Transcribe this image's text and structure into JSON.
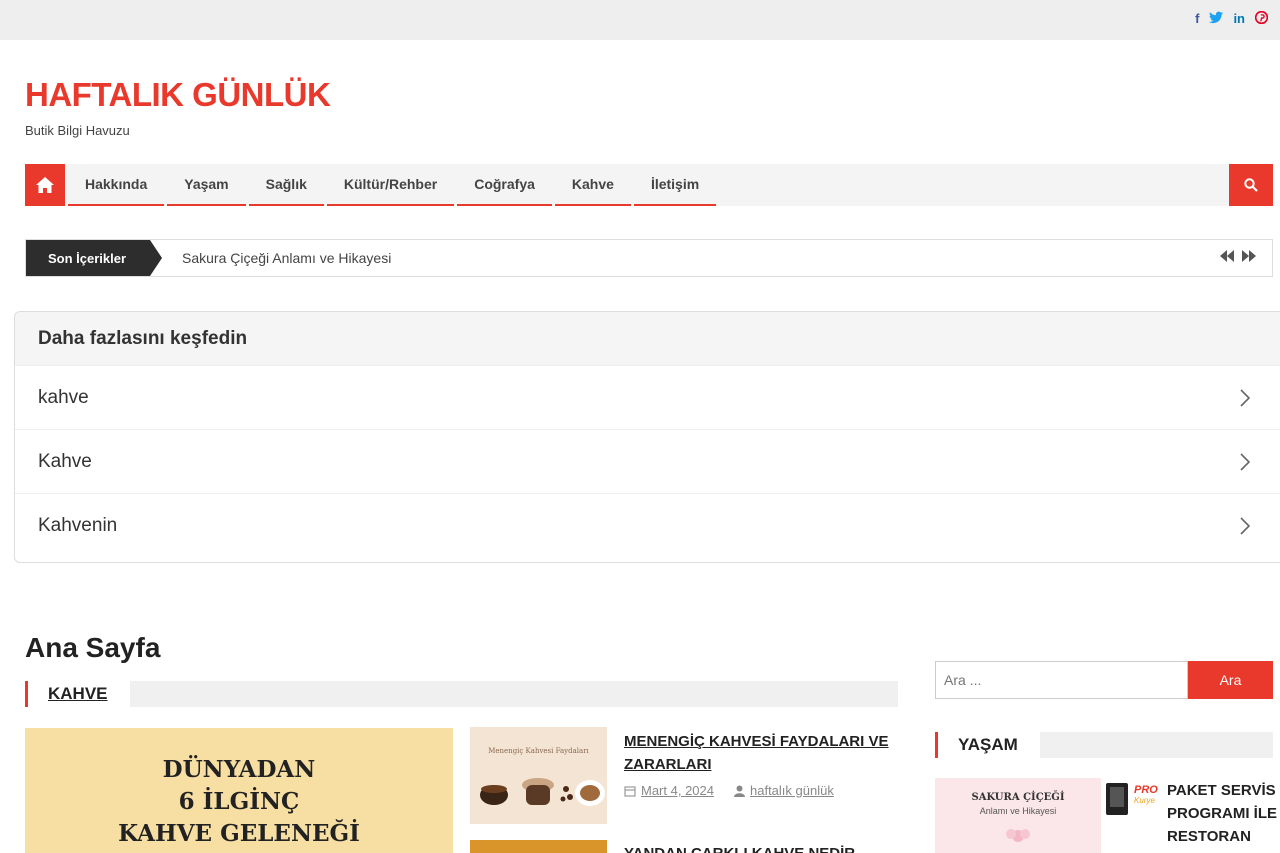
{
  "topbar": {
    "social": [
      {
        "name": "facebook-icon",
        "glyph": "f",
        "color": "#3b5998"
      },
      {
        "name": "twitter-icon",
        "glyph": "t",
        "color": "#1da1f2"
      },
      {
        "name": "linkedin-icon",
        "glyph": "in",
        "color": "#0077b5"
      },
      {
        "name": "pinterest-icon",
        "glyph": "p",
        "color": "#e60023"
      }
    ]
  },
  "site": {
    "title": "HAFTALIK GÜNLÜK",
    "description": "Butik Bilgi Havuzu",
    "accent_color": "#e8392c"
  },
  "nav": {
    "items": [
      "Hakkında",
      "Yaşam",
      "Sağlık",
      "Kültür/Rehber",
      "Coğrafya",
      "Kahve",
      "İletişim"
    ]
  },
  "ticker": {
    "label": "Son İçerikler",
    "text": "Sakura Çiçeği Anlamı ve Hikayesi"
  },
  "explore": {
    "title": "Daha fazlasını keşfedin",
    "items": [
      "kahve",
      "Kahve",
      "Kahvenin"
    ]
  },
  "main": {
    "heading": "Ana Sayfa",
    "section_title": "KAHVE",
    "feature_image_lines": [
      "DÜNYADAN",
      "6 İLGİNÇ",
      "KAHVE GELENEĞİ"
    ],
    "thumb1_caption": "Menengiç Kahvesi Faydaları",
    "posts": [
      {
        "title_line1": "MENENGİÇ KAHVESİ FAYDALARI VE",
        "title_line2": "ZARARLARI",
        "date": "Mart 4, 2024",
        "author": "haftalık günlük"
      },
      {
        "title_line1": "YANDAN ÇARKLI KAHVE NEDİR NASIL"
      }
    ]
  },
  "sidebar": {
    "search_placeholder": "Ara ...",
    "search_button": "Ara",
    "section_title": "YAŞAM",
    "sakura_title": "SAKURA ÇİÇEĞİ",
    "sakura_sub": "Anlamı ve Hikayesi",
    "logo_text": "PRO",
    "logo_text2": "Kurye",
    "post_title": "PAKET SERVİS PROGRAMI İLE RESTORAN"
  }
}
